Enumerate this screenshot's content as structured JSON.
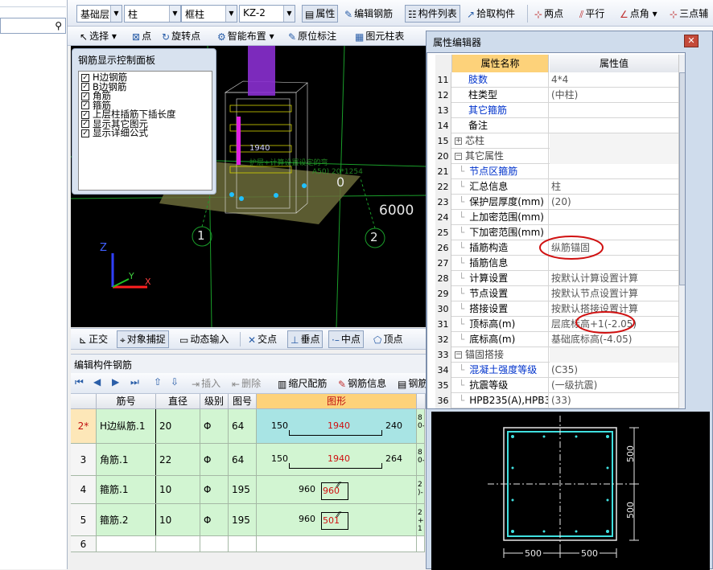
{
  "left_panel": {
    "search_icon": "search-icon"
  },
  "toolbar1": {
    "floor": "基础层",
    "category": "柱",
    "subtype": "框柱",
    "component": "KZ-2",
    "properties": "属性",
    "edit_rebar": "编辑钢筋",
    "component_list": "构件列表",
    "pick_component": "拾取构件",
    "two_points": "两点",
    "parallel": "平行",
    "point_angle": "点角",
    "three_point": "三点辅"
  },
  "toolbar2": {
    "select": "选择",
    "point": "点",
    "rotate_point": "旋转点",
    "smart_layout": "智能布置",
    "in_place_annotation": "原位标注",
    "element_table": "图元柱表"
  },
  "ctrl_panel": {
    "title": "钢筋显示控制面板",
    "items": [
      "H边钢筋",
      "B边钢筋",
      "角筋",
      "箍筋",
      "上层柱插筋下插长度",
      "显示其它图元",
      "显示详细公式"
    ]
  },
  "viewport": {
    "dim_6000": "6000",
    "dim_0": "0",
    "axis_1": "1",
    "axis_2": "2",
    "label_1940": "1940",
    "ghost_text_1": "护层+计算设置设定的弯",
    "ghost_text_2": "A50) 20*1254",
    "axis_x": "X",
    "axis_y": "Y",
    "axis_z": "Z"
  },
  "snapbar": {
    "ortho": "正交",
    "snap": "对象捕捉",
    "dynamic_input": "动态输入",
    "intersection": "交点",
    "perpendicular": "垂点",
    "midpoint": "中点",
    "vertex": "顶点"
  },
  "rebar_editor": {
    "title": "编辑构件钢筋",
    "insert": "插入",
    "delete": "删除",
    "scale": "缩尺配筋",
    "rebar_info": "钢筋信息",
    "rebar_more": "钢筋",
    "headers": [
      "筋号",
      "直径(mm)",
      "级别",
      "图号",
      "图形"
    ],
    "rows": [
      {
        "idx": "2*",
        "name": "H边纵筋.1",
        "dia": "20",
        "grade": "Φ",
        "fig": "64",
        "left": "150",
        "mid": "1940",
        "right": "240",
        "extra": "8\n0-"
      },
      {
        "idx": "3",
        "name": "角筋.1",
        "dia": "22",
        "grade": "Φ",
        "fig": "64",
        "left": "150",
        "mid": "1940",
        "right": "264",
        "extra": "8\n0-"
      },
      {
        "idx": "4",
        "name": "箍筋.1",
        "dia": "10",
        "grade": "Φ",
        "fig": "195",
        "left": "960",
        "mid": "960",
        "right": "",
        "extra": "2\n)-"
      },
      {
        "idx": "5",
        "name": "箍筋.2",
        "dia": "10",
        "grade": "Φ",
        "fig": "195",
        "left": "960",
        "mid": "501",
        "right": "",
        "extra": "2\n+2\n1"
      },
      {
        "idx": "6",
        "name": "",
        "dia": "",
        "grade": "",
        "fig": "",
        "left": "",
        "mid": "",
        "right": "",
        "extra": ""
      }
    ]
  },
  "property_editor": {
    "title": "属性编辑器",
    "col_name": "属性名称",
    "col_value": "属性值",
    "rows": [
      {
        "n": "11",
        "k": "肢数",
        "v": "4*4",
        "style": "blue"
      },
      {
        "n": "12",
        "k": "柱类型",
        "v": "(中柱)",
        "style": ""
      },
      {
        "n": "13",
        "k": "其它箍筋",
        "v": "",
        "style": "blue"
      },
      {
        "n": "14",
        "k": "备注",
        "v": "",
        "style": ""
      },
      {
        "n": "15",
        "k": "芯柱",
        "v": "",
        "style": "group+"
      },
      {
        "n": "20",
        "k": "其它属性",
        "v": "",
        "style": "group-"
      },
      {
        "n": "21",
        "k": "节点区箍筋",
        "v": "",
        "style": "blue-child"
      },
      {
        "n": "22",
        "k": "汇总信息",
        "v": "柱",
        "style": "child"
      },
      {
        "n": "23",
        "k": "保护层厚度(mm)",
        "v": "(20)",
        "style": "child"
      },
      {
        "n": "24",
        "k": "上加密范围(mm)",
        "v": "",
        "style": "child"
      },
      {
        "n": "25",
        "k": "下加密范围(mm)",
        "v": "",
        "style": "child"
      },
      {
        "n": "26",
        "k": "插筋构造",
        "v": "纵筋锚固",
        "style": "child"
      },
      {
        "n": "27",
        "k": "插筋信息",
        "v": "",
        "style": "child"
      },
      {
        "n": "28",
        "k": "计算设置",
        "v": "按默认计算设置计算",
        "style": "child"
      },
      {
        "n": "29",
        "k": "节点设置",
        "v": "按默认节点设置计算",
        "style": "child"
      },
      {
        "n": "30",
        "k": "搭接设置",
        "v": "按默认搭接设置计算",
        "style": "child"
      },
      {
        "n": "31",
        "k": "顶标高(m)",
        "v": "层底标高+1(-2.05)",
        "style": "child"
      },
      {
        "n": "32",
        "k": "底标高(m)",
        "v": "基础底标高(-4.05)",
        "style": "child"
      },
      {
        "n": "33",
        "k": "锚固搭接",
        "v": "",
        "style": "group-"
      },
      {
        "n": "34",
        "k": "混凝土强度等级",
        "v": "(C35)",
        "style": "blue-child"
      },
      {
        "n": "35",
        "k": "抗震等级",
        "v": "(一级抗震)",
        "style": "child"
      },
      {
        "n": "36",
        "k": "HPB235(A),HPB3",
        "v": "(33)",
        "style": "child"
      }
    ],
    "section_dims": {
      "right_top": "500",
      "right_bottom": "500",
      "bottom_left": "500",
      "bottom_right": "500"
    }
  },
  "colors": {
    "viewport_bg": "#000000",
    "grid_row": "#d2f5d2",
    "selected_cell": "#a8e4e4",
    "highlight_header": "#fdd27a",
    "annotation": "#d01010"
  }
}
